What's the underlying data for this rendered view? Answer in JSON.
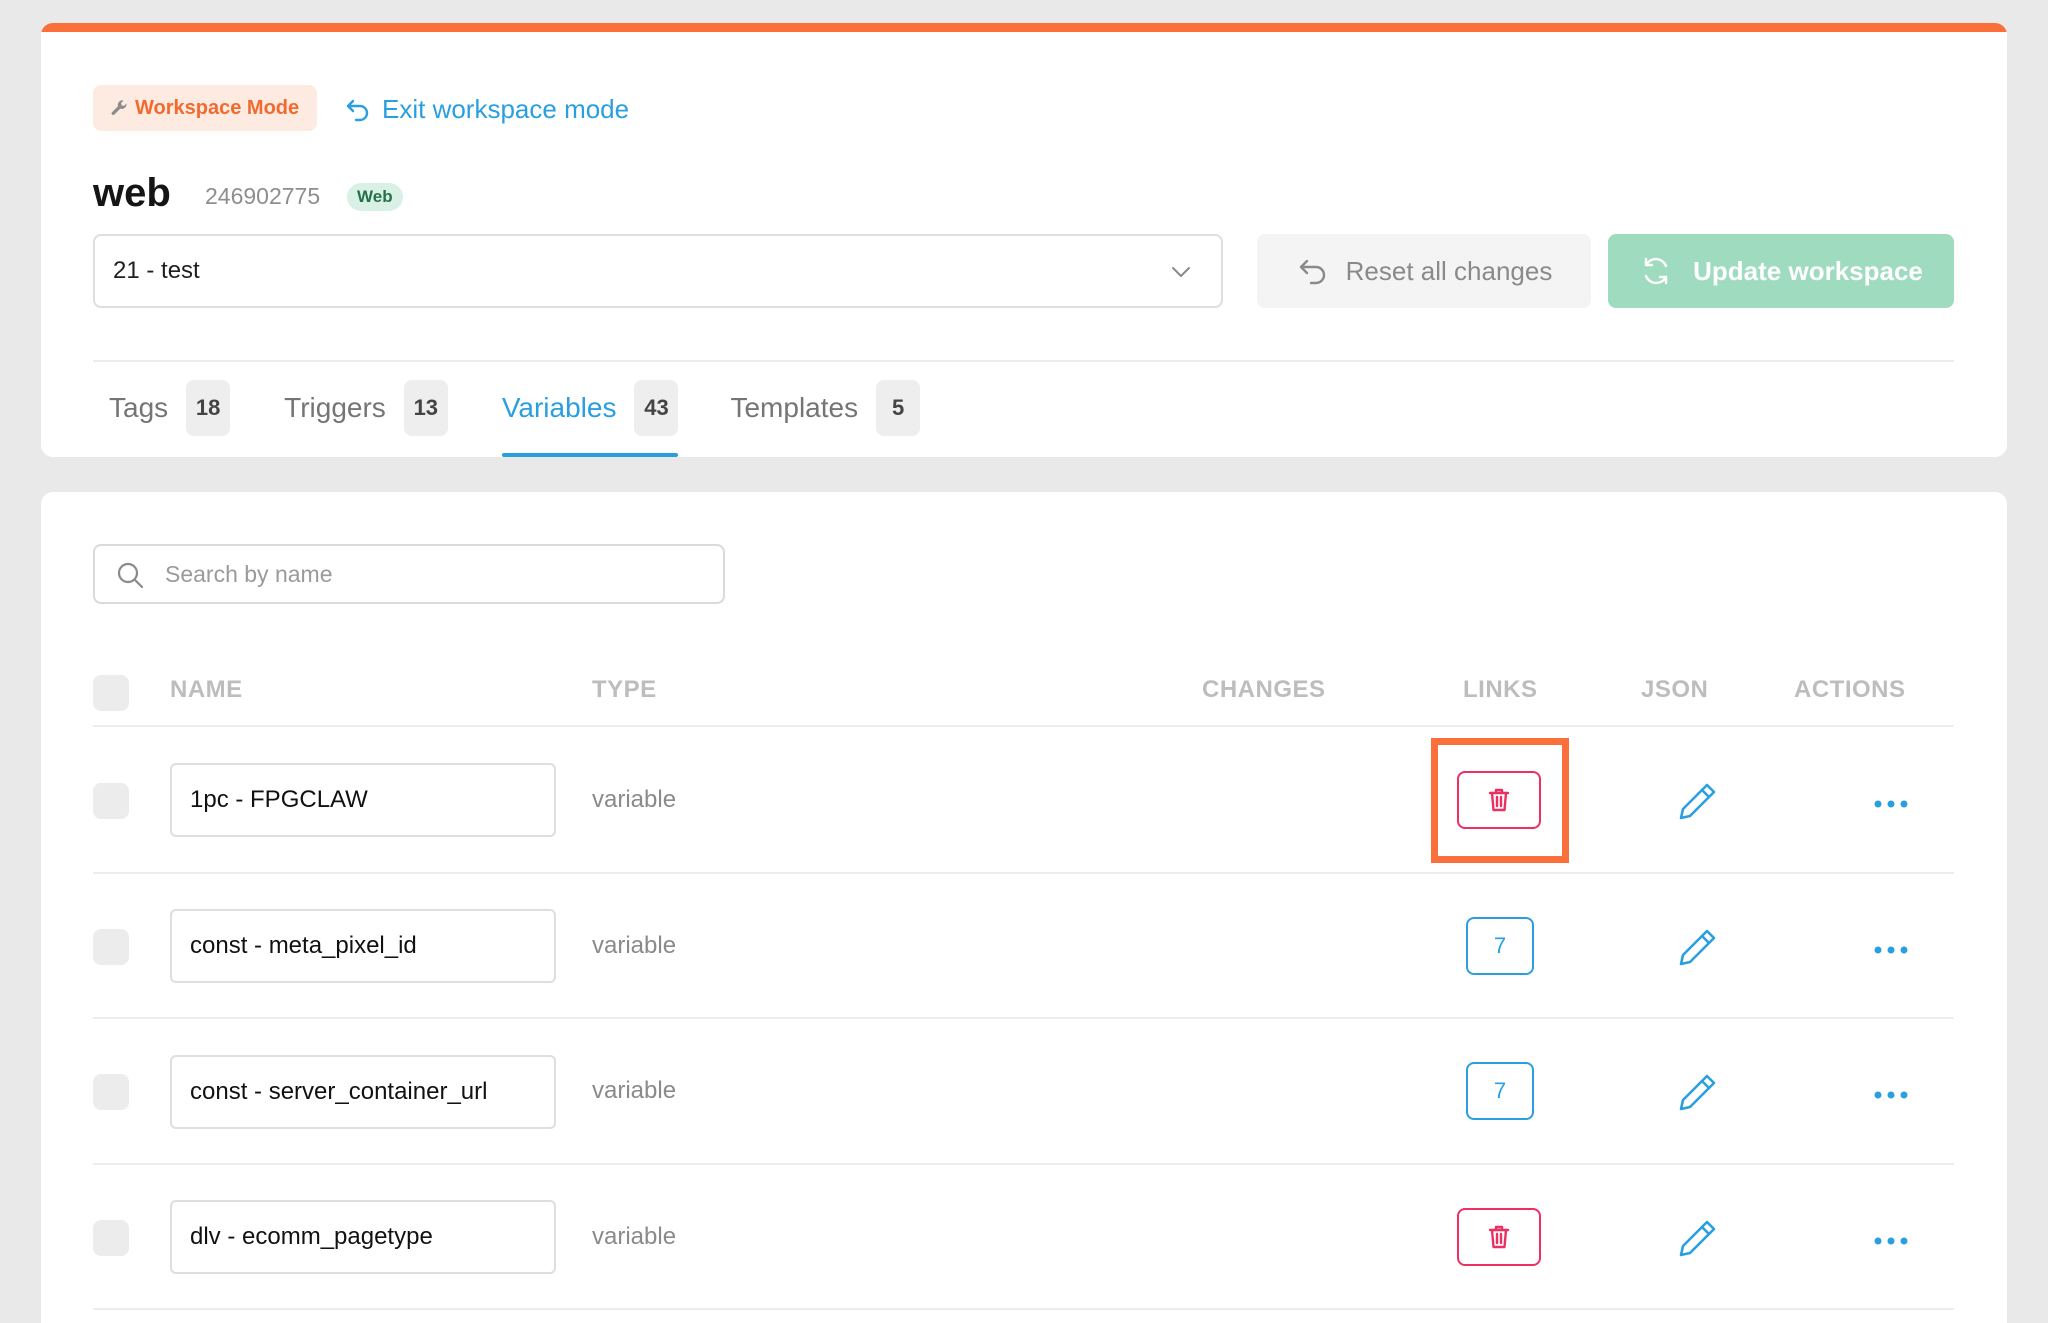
{
  "header": {
    "workspace_badge": "Workspace Mode",
    "exit_link": "Exit workspace mode",
    "container_title": "web",
    "container_id": "246902775",
    "env_badge": "Web",
    "version_select_value": "21 - test",
    "reset_label": "Reset all changes",
    "update_label": "Update workspace"
  },
  "tabs": [
    {
      "label": "Tags",
      "count": "18"
    },
    {
      "label": "Triggers",
      "count": "13"
    },
    {
      "label": "Variables",
      "count": "43"
    },
    {
      "label": "Templates",
      "count": "5"
    }
  ],
  "active_tab": "Variables",
  "search": {
    "placeholder": "Search by name"
  },
  "table": {
    "columns": {
      "name": "NAME",
      "type": "TYPE",
      "changes": "CHANGES",
      "links": "LINKS",
      "json": "JSON",
      "actions": "ACTIONS"
    },
    "rows": [
      {
        "name": "1pc - FPGCLAW",
        "type": "variable",
        "links": "delete",
        "links_count": ""
      },
      {
        "name": "const - meta_pixel_id",
        "type": "variable",
        "links": "count",
        "links_count": "7"
      },
      {
        "name": "const - server_container_url",
        "type": "variable",
        "links": "count",
        "links_count": "7"
      },
      {
        "name": "dlv - ecomm_pagetype",
        "type": "variable",
        "links": "delete",
        "links_count": ""
      }
    ]
  },
  "colors": {
    "accent_orange": "#fb6f3b",
    "link_blue": "#2a9fe0",
    "delete_red": "#ee2f62",
    "update_green": "#9fdbbf"
  },
  "icons": {
    "workspace": "wrench-icon",
    "exit": "undo-arrow-icon",
    "select": "chevron-down-icon",
    "reset": "undo-arrow-icon",
    "update": "refresh-icon",
    "search": "search-icon",
    "delete": "trash-icon",
    "edit": "pencil-icon",
    "more": "more-horizontal-icon"
  }
}
